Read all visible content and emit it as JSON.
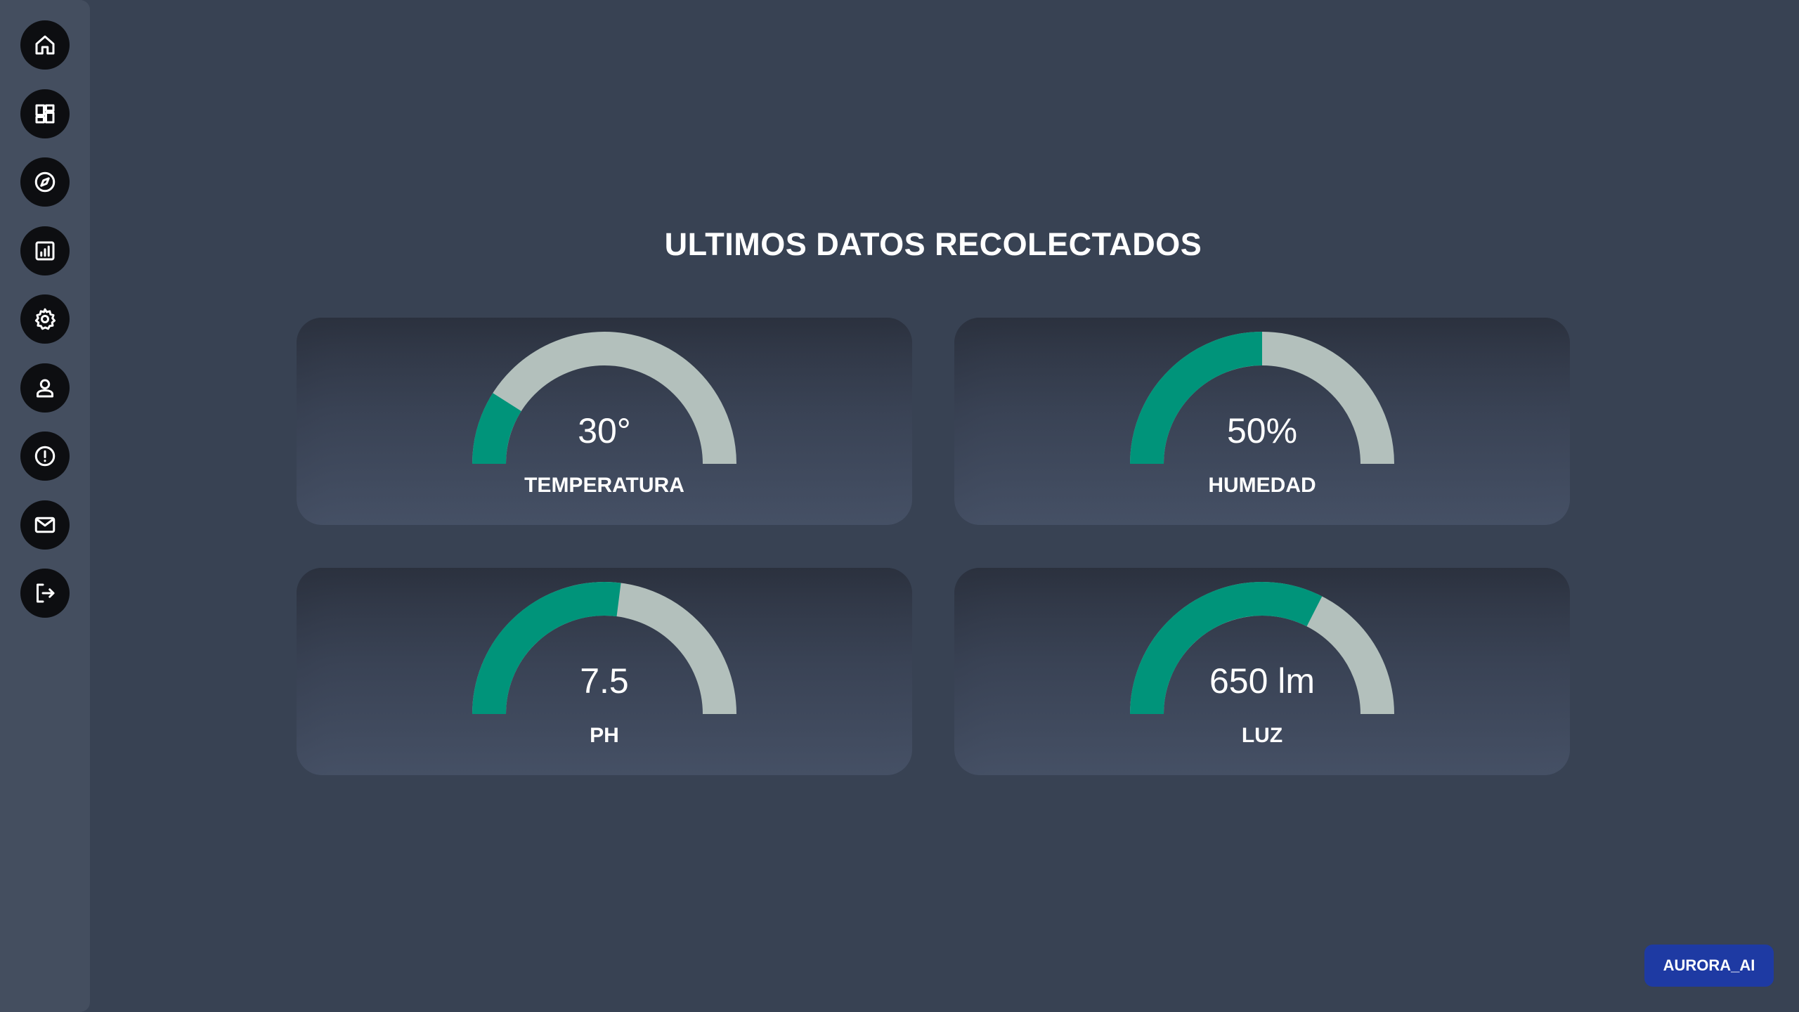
{
  "sidebar": {
    "items": [
      {
        "icon": "home-icon",
        "name": "home"
      },
      {
        "icon": "dashboard-icon",
        "name": "dashboard"
      },
      {
        "icon": "compass-icon",
        "name": "explore"
      },
      {
        "icon": "report-chart-icon",
        "name": "reports"
      },
      {
        "icon": "gear-icon",
        "name": "settings"
      },
      {
        "icon": "user-icon",
        "name": "profile"
      },
      {
        "icon": "alert-icon",
        "name": "alerts"
      },
      {
        "icon": "mail-icon",
        "name": "messages"
      },
      {
        "icon": "logout-icon",
        "name": "logout"
      }
    ]
  },
  "main": {
    "title": "ULTIMOS DATOS RECOLECTADOS"
  },
  "gauges": [
    {
      "value_text": "30°",
      "label": "TEMPERATURA",
      "fraction": 0.18
    },
    {
      "value_text": "50%",
      "label": "HUMEDAD",
      "fraction": 0.5
    },
    {
      "value_text": "7.5",
      "label": "PH",
      "fraction": 0.54
    },
    {
      "value_text": "650 lm",
      "label": "LUZ",
      "fraction": 0.65
    }
  ],
  "colors": {
    "gauge_fill": "#00947a",
    "gauge_track": "#b3c0bc",
    "background": "#384253",
    "sidebar": "#444e5f",
    "badge": "#1e3aa3"
  },
  "badge": {
    "label": "AURORA_AI"
  }
}
